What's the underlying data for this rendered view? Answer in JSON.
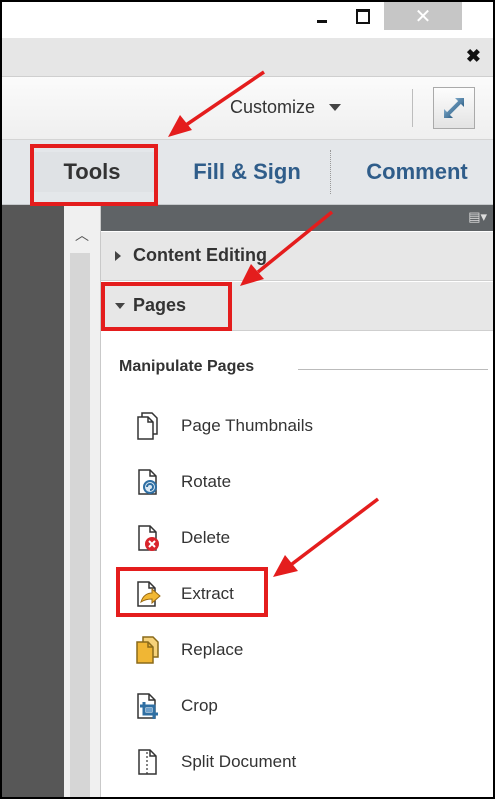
{
  "window": {
    "minimize_icon": "minimize-icon",
    "maximize_icon": "restore-icon",
    "close_glyph": "✕",
    "pane_close_glyph": "✖"
  },
  "toolbar": {
    "customize_label": "Customize",
    "expand_icon": "fullscreen-icon"
  },
  "tabs": [
    {
      "label": "Tools",
      "active": true
    },
    {
      "label": "Fill & Sign",
      "active": false
    },
    {
      "label": "Comment",
      "active": false
    }
  ],
  "panel": {
    "sections": [
      {
        "label": "Content Editing",
        "expanded": false
      },
      {
        "label": "Pages",
        "expanded": true
      }
    ],
    "group_title": "Manipulate Pages",
    "items": [
      {
        "label": "Page Thumbnails",
        "icon": "page-thumbnails-icon"
      },
      {
        "label": "Rotate",
        "icon": "rotate-page-icon"
      },
      {
        "label": "Delete",
        "icon": "delete-page-icon"
      },
      {
        "label": "Extract",
        "icon": "extract-page-icon"
      },
      {
        "label": "Replace",
        "icon": "replace-page-icon"
      },
      {
        "label": "Crop",
        "icon": "crop-page-icon"
      },
      {
        "label": "Split Document",
        "icon": "split-document-icon"
      }
    ]
  },
  "annotations": {
    "highlight_color": "#e41d1d",
    "arrow_color": "#e41d1d"
  }
}
